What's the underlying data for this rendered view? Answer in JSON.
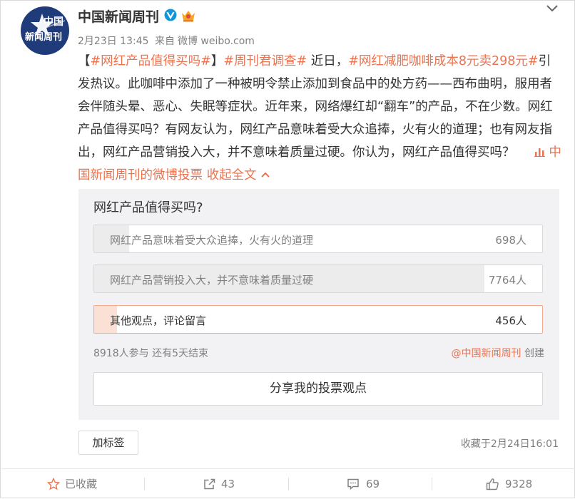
{
  "post": {
    "author": "中国新闻周刊",
    "avatar_text_line1": "中国",
    "avatar_text_line2": "新闻周刊",
    "verified_icon": "verified-v-icon",
    "member_icon": "crown-icon",
    "date": "2月23日 13:45",
    "source_prefix": "来自",
    "source": "微博 weibo.com",
    "content": {
      "bracket_open": "【",
      "tag1": "#网红产品值得买吗#",
      "bracket_close": "】",
      "tag2": "#周刊君调查#",
      "text1": " 近日，",
      "tag3": "#网红减肥咖啡成本8元卖298元#",
      "text2": "引发热议。此咖啡中添加了一种被明令禁止添加到食品中的处方药——西布曲明，服用者会伴随头晕、恶心、失眠等症状。近年来，网络爆红却“翻车”的产品，不在少数。网红产品值得买吗？有网友认为，网红产品意味着受大众追捧，火有火的道理；也有网友指出，网红产品营销投入大，并不意味着质量过硬。你认为，网红产品值得买吗？",
      "vote_link": "中国新闻周刊的微博投票",
      "collapse_link": "收起全文"
    },
    "accent_color": "#eb7350"
  },
  "poll": {
    "question": "网红产品值得买吗?",
    "options": [
      {
        "label": "网红产品意味着受大众追捧，火有火的道理",
        "count": "698人",
        "share": 0.078,
        "selected": false
      },
      {
        "label": "网红产品营销投入大，并不意味着质量过硬",
        "count": "7764人",
        "share": 0.871,
        "selected": false
      },
      {
        "label": "其他观点，评论留言",
        "count": "456人",
        "share": 0.051,
        "selected": true
      }
    ],
    "stats": "8918人参与 还有5天结束",
    "creator_link": "@中国新闻周刊",
    "creator_suffix": "创建",
    "share_button": "分享我的投票观点"
  },
  "footer": {
    "tag_button": "加标签",
    "fav_time": "收藏于2月24日16:01"
  },
  "actions": {
    "favorite": "已收藏",
    "repost": "43",
    "comment": "69",
    "like": "9328"
  }
}
